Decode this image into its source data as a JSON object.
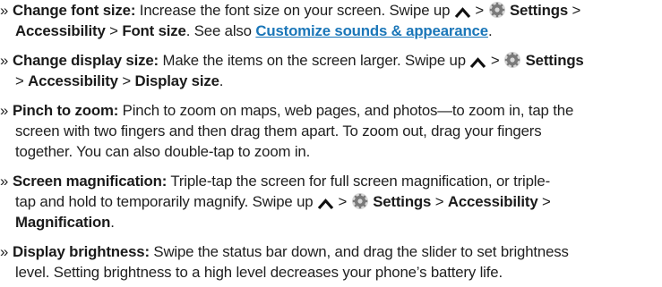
{
  "chevron": "»",
  "items": [
    {
      "title": "Change font size:",
      "t1": " Increase the font size on your screen. Swipe up ",
      "t2": " > ",
      "settings": " Settings",
      "t3": " >",
      "accessibility": "Accessibility",
      "sep": " > ",
      "font_size": "Font size",
      "see_also": ". See also ",
      "link": "Customize sounds & appearance",
      "end": "."
    },
    {
      "title": "Change display size:",
      "t1": " Make the items on the screen larger. Swipe up ",
      "t2": " > ",
      "settings": " Settings",
      "sep1": "> ",
      "accessibility": "Accessibility",
      "sep2": " > ",
      "display_size": "Display size",
      "end": "."
    },
    {
      "title": "Pinch to zoom:",
      "line1": " Pinch to zoom on maps, web pages, and photos—to zoom in, tap the",
      "line2": "screen with two fingers and then drag them apart. To zoom out, drag your fingers",
      "line3": "together. You can also double-tap to zoom in."
    },
    {
      "title": "Screen magnification:",
      "line1": " Triple-tap the screen for full screen magnification, or triple-",
      "t2": "tap and hold to temporarily magnify. Swipe up ",
      "t3": " > ",
      "settings": " Settings",
      "sep1": " > ",
      "accessibility": "Accessibility",
      "sep2": " >",
      "magnification": "Magnification",
      "end": "."
    },
    {
      "title": "Display brightness:",
      "line1": " Swipe the status bar down, and drag the slider to set brightness",
      "line2": "level. Setting brightness to a high level decreases your phone’s battery life."
    }
  ],
  "icons": {
    "up": "chevron-up-icon",
    "settings": "settings-gear-icon"
  },
  "colors": {
    "text": "#1f1f1f",
    "link": "#1a76b8",
    "gear": "#7a7a7a"
  }
}
